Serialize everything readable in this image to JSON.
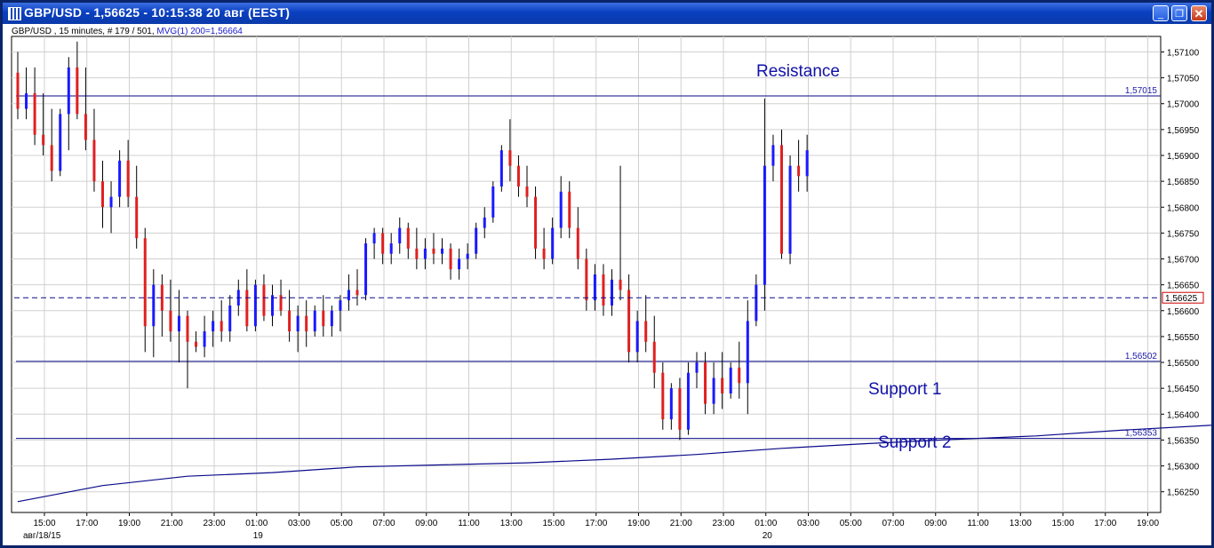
{
  "window": {
    "title": "GBP/USD - 1,56625 - 10:15:38  20 авг (EEST)",
    "controls": {
      "minimize": "_",
      "maximize": "❐",
      "close": "✕"
    }
  },
  "info": {
    "symbol_line": "GBP/USD , 15 minutes, # 179 / 501, ",
    "indicator_line": "MVG(1) 200=1,56664"
  },
  "colors": {
    "up": "#1a1aff",
    "down": "#e02020",
    "line": "#0a0a8a",
    "grid": "#d0d0d0",
    "current_price_box": "#cc0000"
  },
  "chart_data": {
    "type": "line",
    "title": "",
    "ylim": [
      1.5621,
      1.5713
    ],
    "y_ticks": [
      "1,56250",
      "1,56300",
      "1,56350",
      "1,56400",
      "1,56450",
      "1,56500",
      "1,56550",
      "1,56600",
      "1,56650",
      "1,56700",
      "1,56750",
      "1,56800",
      "1,56850",
      "1,56900",
      "1,56950",
      "1,57000",
      "1,57050",
      "1,57100"
    ],
    "x_ticks": [
      "15:00",
      "17:00",
      "19:00",
      "21:00",
      "23:00",
      "01:00",
      "03:00",
      "05:00",
      "07:00",
      "09:00",
      "11:00",
      "13:00",
      "15:00",
      "17:00",
      "19:00",
      "21:00",
      "23:00",
      "01:00",
      "03:00",
      "05:00",
      "07:00",
      "09:00",
      "11:00",
      "13:00",
      "15:00",
      "17:00",
      "19:00"
    ],
    "x_dates": [
      {
        "label": "авг/18/15",
        "tick": 0
      },
      {
        "label": "19",
        "tick": 5
      },
      {
        "label": "20",
        "tick": 17
      }
    ],
    "horizontal_levels": [
      {
        "name": "Resistance",
        "value": 1.57015,
        "label": "1,57015",
        "text": "Resistance"
      },
      {
        "name": "Support 1",
        "value": 1.56502,
        "label": "1,56502",
        "text": "Support 1"
      },
      {
        "name": "Support 2",
        "value": 1.56353,
        "label": "1,56353",
        "text": "Support 2"
      }
    ],
    "current_price": {
      "value": 1.56625,
      "label": "1,56625"
    },
    "series": [
      {
        "name": "MVG(1) 200",
        "type": "line",
        "points": [
          [
            0,
            1.56231
          ],
          [
            2,
            1.56262
          ],
          [
            4,
            1.5628
          ],
          [
            6,
            1.56287
          ],
          [
            8,
            1.56298
          ],
          [
            10,
            1.56302
          ],
          [
            12,
            1.56306
          ],
          [
            14,
            1.56313
          ],
          [
            16,
            1.56322
          ],
          [
            18,
            1.56334
          ],
          [
            20,
            1.56343
          ],
          [
            22,
            1.56351
          ],
          [
            24,
            1.56358
          ],
          [
            26,
            1.56369
          ],
          [
            28,
            1.56378
          ],
          [
            29.3,
            1.56384
          ],
          [
            30,
            1.56393
          ],
          [
            32,
            1.56426
          ],
          [
            34,
            1.56467
          ],
          [
            36,
            1.5651
          ],
          [
            38,
            1.56555
          ],
          [
            40,
            1.56596
          ],
          [
            42,
            1.56637
          ],
          [
            43.2,
            1.56664
          ]
        ]
      }
    ],
    "candles_ohlc": [
      [
        0,
        1.5706,
        1.571,
        1.5697,
        1.5699
      ],
      [
        0.2,
        1.5699,
        1.5707,
        1.5697,
        1.5702
      ],
      [
        0.4,
        1.5702,
        1.5707,
        1.5692,
        1.5694
      ],
      [
        0.6,
        1.5694,
        1.5702,
        1.569,
        1.5692
      ],
      [
        0.8,
        1.5692,
        1.5699,
        1.5685,
        1.5687
      ],
      [
        1,
        1.5687,
        1.5699,
        1.5686,
        1.5698
      ],
      [
        1.2,
        1.5698,
        1.5709,
        1.5691,
        1.5707
      ],
      [
        1.4,
        1.5707,
        1.5712,
        1.5697,
        1.5698
      ],
      [
        1.6,
        1.5698,
        1.5707,
        1.5691,
        1.5693
      ],
      [
        1.8,
        1.5693,
        1.5699,
        1.5683,
        1.5685
      ],
      [
        2,
        1.5685,
        1.5689,
        1.5676,
        1.568
      ],
      [
        2.2,
        1.568,
        1.5685,
        1.5675,
        1.5682
      ],
      [
        2.4,
        1.5682,
        1.5691,
        1.568,
        1.5689
      ],
      [
        2.6,
        1.5689,
        1.5693,
        1.568,
        1.5682
      ],
      [
        2.8,
        1.5682,
        1.5688,
        1.5672,
        1.5674
      ],
      [
        3,
        1.5674,
        1.5676,
        1.5652,
        1.5657
      ],
      [
        3.2,
        1.5657,
        1.5668,
        1.5651,
        1.5665
      ],
      [
        3.4,
        1.5665,
        1.5667,
        1.5655,
        1.566
      ],
      [
        3.6,
        1.566,
        1.5666,
        1.5654,
        1.5656
      ],
      [
        3.8,
        1.5656,
        1.5664,
        1.565,
        1.5659
      ],
      [
        4,
        1.5659,
        1.566,
        1.5645,
        1.5654
      ],
      [
        4.2,
        1.5654,
        1.5656,
        1.5652,
        1.5653
      ],
      [
        4.4,
        1.5653,
        1.5659,
        1.5651,
        1.5656
      ],
      [
        4.6,
        1.5656,
        1.566,
        1.5653,
        1.5658
      ],
      [
        4.8,
        1.5658,
        1.5662,
        1.5654,
        1.5656
      ],
      [
        5,
        1.5656,
        1.5663,
        1.5654,
        1.5661
      ],
      [
        5.2,
        1.5661,
        1.5666,
        1.5659,
        1.5664
      ],
      [
        5.4,
        1.5664,
        1.5668,
        1.5656,
        1.5657
      ],
      [
        5.6,
        1.5657,
        1.5666,
        1.5656,
        1.5665
      ],
      [
        5.8,
        1.5665,
        1.5667,
        1.5658,
        1.5659
      ],
      [
        6,
        1.5659,
        1.5665,
        1.5657,
        1.5663
      ],
      [
        6.2,
        1.5663,
        1.5666,
        1.5659,
        1.566
      ],
      [
        6.4,
        1.566,
        1.5664,
        1.5654,
        1.5656
      ],
      [
        6.6,
        1.5656,
        1.5661,
        1.5652,
        1.5659
      ],
      [
        6.8,
        1.5659,
        1.5662,
        1.5653,
        1.5656
      ],
      [
        7,
        1.5656,
        1.5661,
        1.5655,
        1.566
      ],
      [
        7.2,
        1.566,
        1.5663,
        1.5655,
        1.5657
      ],
      [
        7.4,
        1.5657,
        1.5661,
        1.5655,
        1.566
      ],
      [
        7.6,
        1.566,
        1.5663,
        1.5656,
        1.5662
      ],
      [
        7.8,
        1.5662,
        1.5667,
        1.566,
        1.5664
      ],
      [
        8,
        1.5664,
        1.5668,
        1.5661,
        1.5663
      ],
      [
        8.2,
        1.5663,
        1.5674,
        1.5662,
        1.5673
      ],
      [
        8.4,
        1.5673,
        1.5676,
        1.567,
        1.5675
      ],
      [
        8.6,
        1.5675,
        1.5676,
        1.5669,
        1.5671
      ],
      [
        8.8,
        1.5671,
        1.5675,
        1.5669,
        1.5673
      ],
      [
        9,
        1.5673,
        1.5678,
        1.5671,
        1.5676
      ],
      [
        9.2,
        1.5676,
        1.5677,
        1.567,
        1.5672
      ],
      [
        9.4,
        1.5672,
        1.5676,
        1.5668,
        1.567
      ],
      [
        9.6,
        1.567,
        1.5674,
        1.5668,
        1.5672
      ],
      [
        9.8,
        1.5672,
        1.5675,
        1.5669,
        1.5671
      ],
      [
        10,
        1.5671,
        1.5674,
        1.5669,
        1.5672
      ],
      [
        10.2,
        1.5672,
        1.5673,
        1.5666,
        1.5668
      ],
      [
        10.4,
        1.5668,
        1.5672,
        1.5666,
        1.567
      ],
      [
        10.6,
        1.567,
        1.5673,
        1.5668,
        1.5671
      ],
      [
        10.8,
        1.5671,
        1.5677,
        1.567,
        1.5676
      ],
      [
        11,
        1.5676,
        1.568,
        1.5674,
        1.5678
      ],
      [
        11.2,
        1.5678,
        1.5685,
        1.5677,
        1.5684
      ],
      [
        11.4,
        1.5684,
        1.5692,
        1.5683,
        1.5691
      ],
      [
        11.6,
        1.5691,
        1.5697,
        1.5685,
        1.5688
      ],
      [
        11.8,
        1.5688,
        1.569,
        1.5682,
        1.5684
      ],
      [
        12,
        1.5684,
        1.5688,
        1.568,
        1.5682
      ],
      [
        12.2,
        1.5682,
        1.5684,
        1.567,
        1.5672
      ],
      [
        12.4,
        1.5672,
        1.5676,
        1.5668,
        1.567
      ],
      [
        12.6,
        1.567,
        1.5678,
        1.5669,
        1.5676
      ],
      [
        12.8,
        1.5676,
        1.5686,
        1.5674,
        1.5683
      ],
      [
        13,
        1.5683,
        1.5685,
        1.5674,
        1.5676
      ],
      [
        13.2,
        1.5676,
        1.568,
        1.5668,
        1.567
      ],
      [
        13.4,
        1.567,
        1.5672,
        1.566,
        1.5662
      ],
      [
        13.6,
        1.5662,
        1.5669,
        1.566,
        1.5667
      ],
      [
        13.8,
        1.5667,
        1.5669,
        1.5659,
        1.5661
      ],
      [
        14,
        1.5661,
        1.5668,
        1.5659,
        1.5666
      ],
      [
        14.2,
        1.5666,
        1.5688,
        1.5662,
        1.5664
      ],
      [
        14.4,
        1.5664,
        1.5667,
        1.565,
        1.5652
      ],
      [
        14.6,
        1.5652,
        1.566,
        1.565,
        1.5658
      ],
      [
        14.8,
        1.5658,
        1.5663,
        1.5652,
        1.5654
      ],
      [
        15,
        1.5654,
        1.5659,
        1.5645,
        1.5648
      ],
      [
        15.2,
        1.5648,
        1.565,
        1.5637,
        1.5639
      ],
      [
        15.4,
        1.5639,
        1.5646,
        1.5637,
        1.5645
      ],
      [
        15.6,
        1.5645,
        1.5647,
        1.5635,
        1.5637
      ],
      [
        15.8,
        1.5637,
        1.565,
        1.5636,
        1.5648
      ],
      [
        16,
        1.5648,
        1.5652,
        1.5645,
        1.565
      ],
      [
        16.2,
        1.565,
        1.5652,
        1.564,
        1.5642
      ],
      [
        16.4,
        1.5642,
        1.565,
        1.564,
        1.5647
      ],
      [
        16.6,
        1.5647,
        1.5652,
        1.5641,
        1.5644
      ],
      [
        16.8,
        1.5644,
        1.565,
        1.5643,
        1.5649
      ],
      [
        17,
        1.5649,
        1.5654,
        1.5643,
        1.5646
      ],
      [
        17.2,
        1.5646,
        1.5662,
        1.564,
        1.5658
      ],
      [
        17.4,
        1.5658,
        1.5667,
        1.5657,
        1.5665
      ],
      [
        17.6,
        1.5665,
        1.5701,
        1.566,
        1.5688
      ],
      [
        17.8,
        1.5688,
        1.5694,
        1.5685,
        1.5692
      ],
      [
        18,
        1.5692,
        1.5695,
        1.567,
        1.5671
      ],
      [
        18.2,
        1.5671,
        1.569,
        1.5669,
        1.5688
      ],
      [
        18.4,
        1.5688,
        1.5693,
        1.5683,
        1.5686
      ],
      [
        18.6,
        1.5686,
        1.5694,
        1.5683,
        1.5691
      ]
    ]
  }
}
